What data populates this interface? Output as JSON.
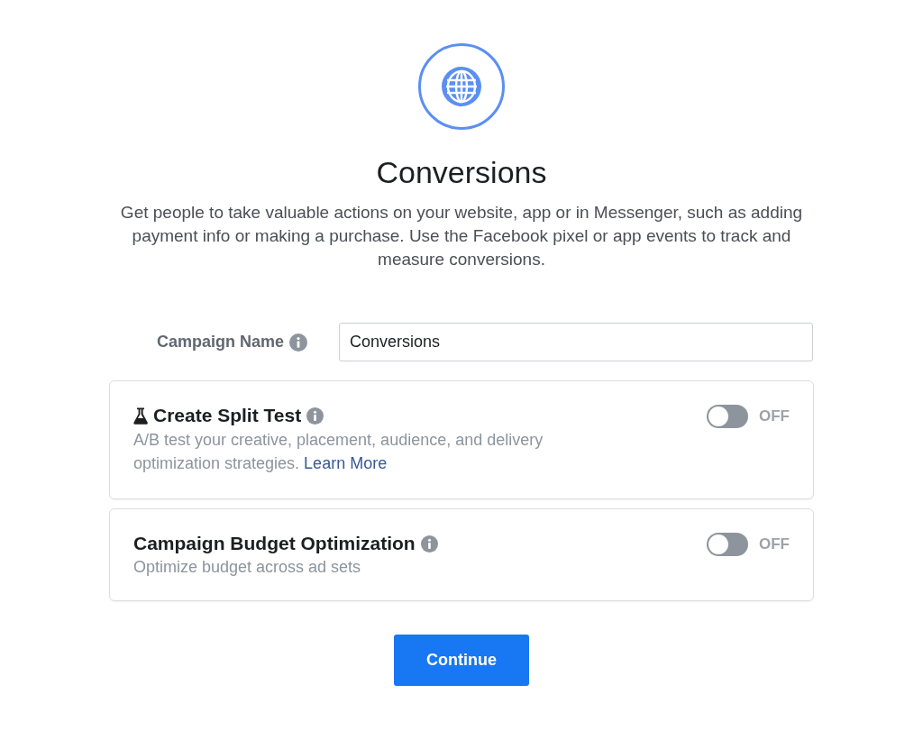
{
  "header": {
    "title": "Conversions",
    "description": "Get people to take valuable actions on your website, app or in Messenger, such as adding payment info or making a purchase. Use the Facebook pixel or app events to track and measure conversions."
  },
  "campaign_name": {
    "label": "Campaign Name",
    "value": "Conversions"
  },
  "options": [
    {
      "kind": "experiment",
      "title": "Create Split Test",
      "description": "A/B test your creative, placement, audience, and delivery optimization strategies.",
      "link": "Learn More",
      "on": false,
      "status": "OFF"
    },
    {
      "kind": "plain",
      "title": "Campaign Budget Optimization",
      "description": "Optimize budget across ad sets",
      "on": false,
      "status": "OFF"
    }
  ],
  "continue_button": "Continue"
}
